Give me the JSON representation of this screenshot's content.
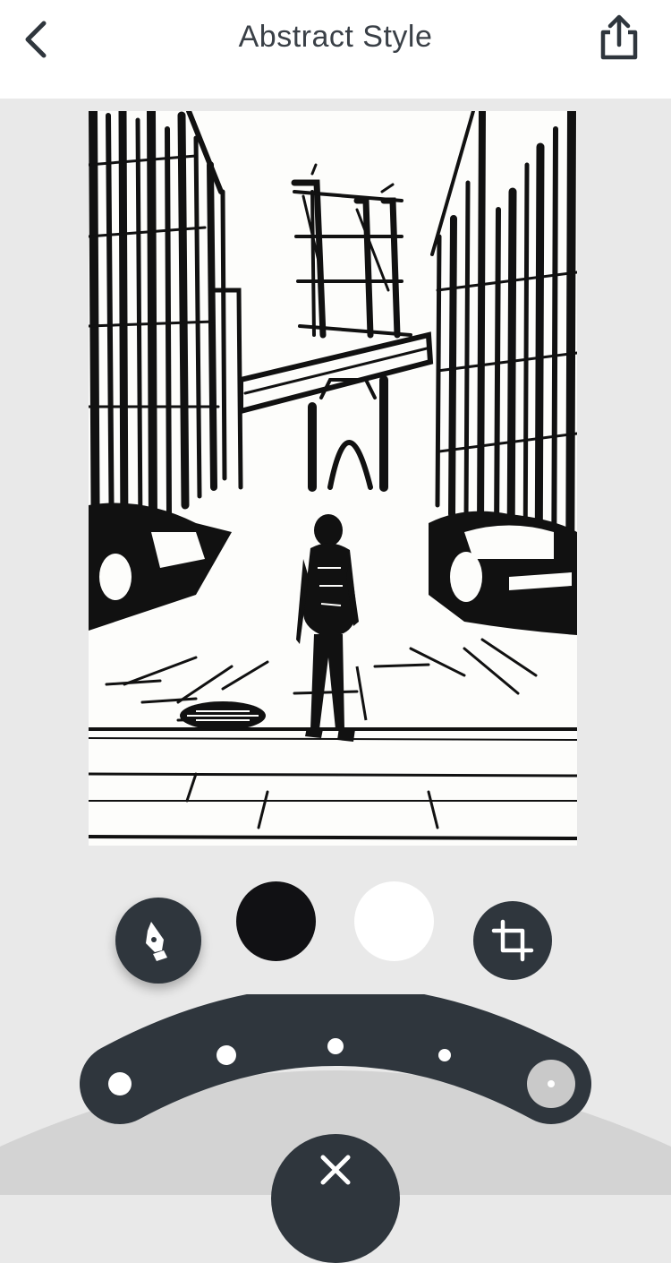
{
  "header": {
    "title": "Abstract Style",
    "back_icon": "chevron-left-icon",
    "share_icon": "share-icon"
  },
  "artwork": {
    "style": "black-and-white abstract sketch"
  },
  "tools": {
    "pen_icon": "pen-nib-icon",
    "swatches": [
      {
        "name": "black",
        "color": "#111114"
      },
      {
        "name": "white",
        "color": "#ffffff"
      }
    ],
    "crop_icon": "crop-icon"
  },
  "slider": {
    "stops": 5,
    "selected_stop": 5
  },
  "bottom": {
    "close_icon": "close-icon"
  },
  "colors": {
    "background": "#e9e9e9",
    "header": "#ffffff",
    "dark_control": "#2f363d",
    "title_text": "#3a4047"
  }
}
